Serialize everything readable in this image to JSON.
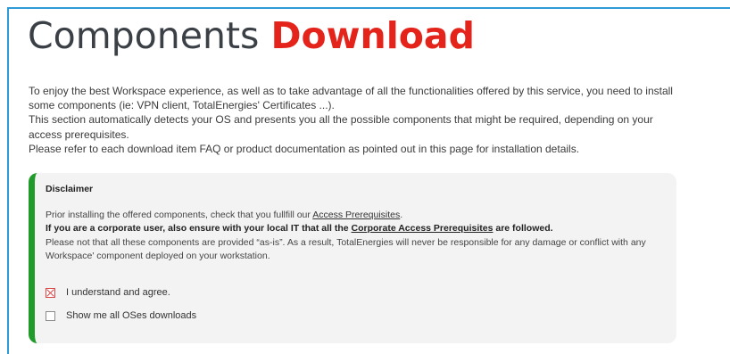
{
  "page": {
    "title_plain": "Components ",
    "title_accent": "Download",
    "accent_color": "#e4241b",
    "frame_color": "#2f9bd6"
  },
  "intro": {
    "p1": "To enjoy the best Workspace experience, as well as to take advantage of all the functionalities offered by this service, you need to install some components (ie: VPN client, TotalEnergies' Certificates ...).",
    "p2": "This section automatically detects your OS and presents you all the possible components that might be required, depending on your access prerequisites.",
    "p3": "Please refer to each download item FAQ or product documentation as pointed out in this page for installation details."
  },
  "disclaimer": {
    "heading": "Disclaimer",
    "accent_color": "#1f9a2b",
    "line1_prefix": "Prior installing the offered components, check that you fullfill our ",
    "line1_link": "Access Prerequisites",
    "line1_suffix": ".",
    "line2_prefix": "If you are a corporate user, also ensure with your local IT that all the ",
    "line2_link": "Corporate Access Prerequisites",
    "line2_suffix": " are followed.",
    "line3": "Please not that all these components are provided “as-is”. As a result, TotalEnergies will never be responsible for any damage or conflict with any Workspace' component deployed on your workstation."
  },
  "checkboxes": {
    "agree": {
      "label": "I understand and agree.",
      "checked": true
    },
    "all_os": {
      "label": "Show me all OSes downloads",
      "checked": false
    }
  }
}
